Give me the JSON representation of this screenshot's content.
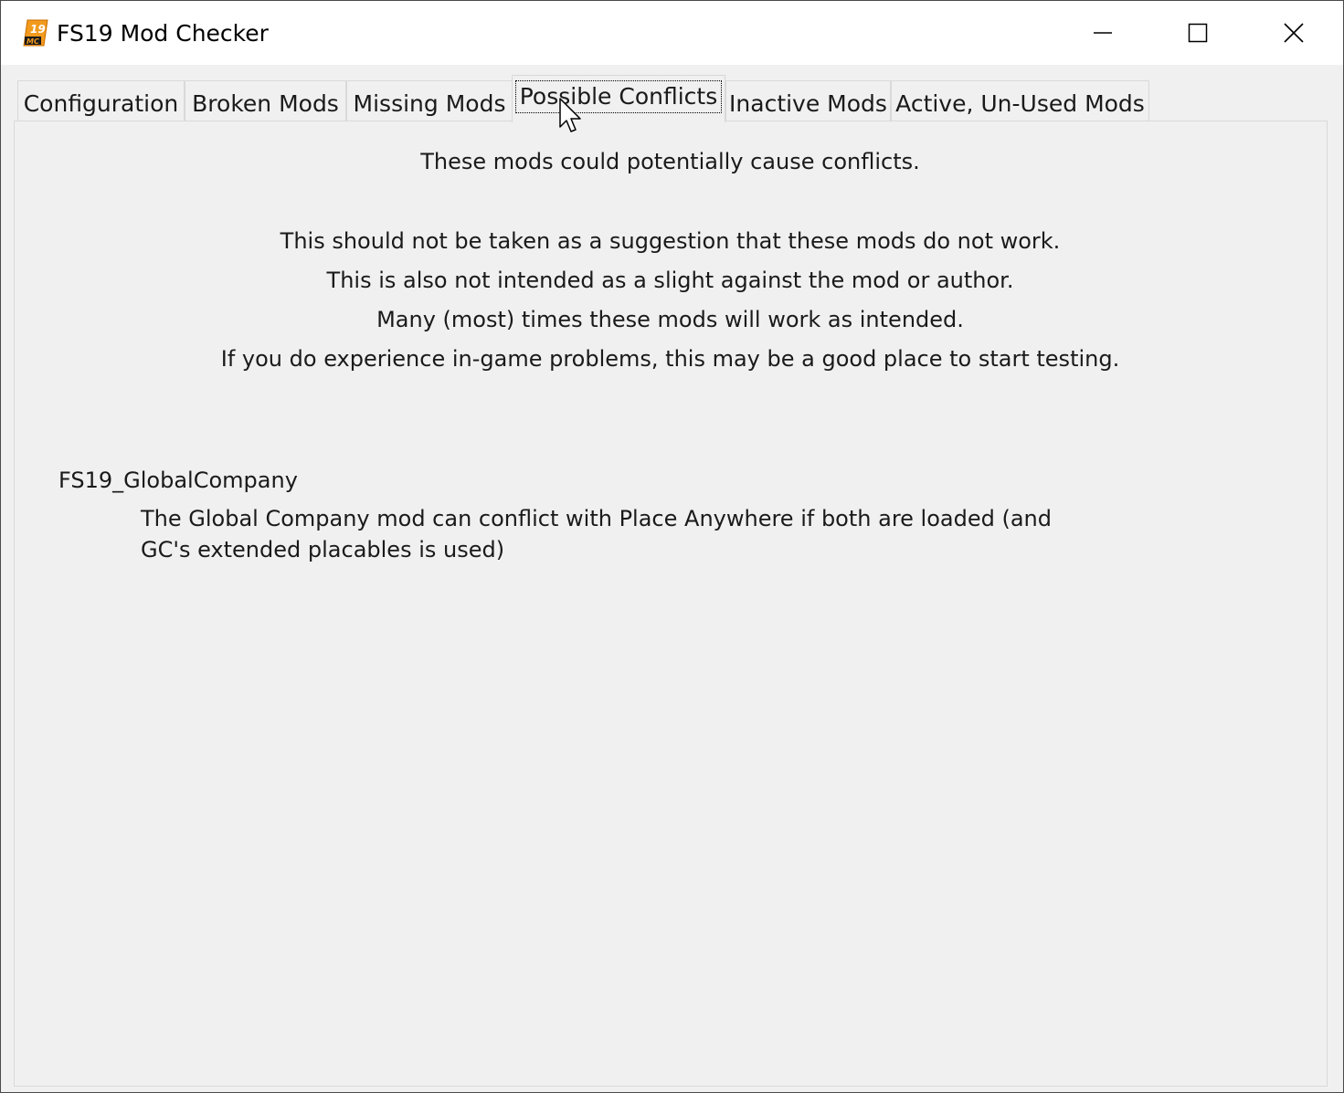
{
  "window": {
    "title": "FS19 Mod Checker",
    "icon_label": "19 MC"
  },
  "title_buttons": {
    "minimize": "minimize",
    "maximize": "maximize",
    "close": "close"
  },
  "tabs": [
    {
      "label": "Configuration",
      "active": false
    },
    {
      "label": "Broken Mods",
      "active": false
    },
    {
      "label": "Missing Mods",
      "active": false
    },
    {
      "label": "Possible Conflicts",
      "active": true
    },
    {
      "label": "Inactive Mods",
      "active": false
    },
    {
      "label": "Active, Un-Used Mods",
      "active": false
    }
  ],
  "conflicts": {
    "heading": "These mods could potentially cause conflicts.",
    "notes": [
      "This should not be taken as a suggestion that these mods do not work.",
      "This is also not intended as a slight against the mod or author.",
      "Many (most) times these mods will work as intended.",
      "If you do experience in-game problems, this may be a good place to start testing."
    ],
    "items": [
      {
        "name": "FS19_GlobalCompany",
        "description": "The Global Company mod can conflict with Place Anywhere if both are loaded (and GC's extended placables is used)"
      }
    ]
  },
  "colors": {
    "window_bg": "#f0f0f0",
    "titlebar_bg": "#ffffff",
    "text": "#1a1a1a",
    "icon_orange": "#f29a1e"
  }
}
